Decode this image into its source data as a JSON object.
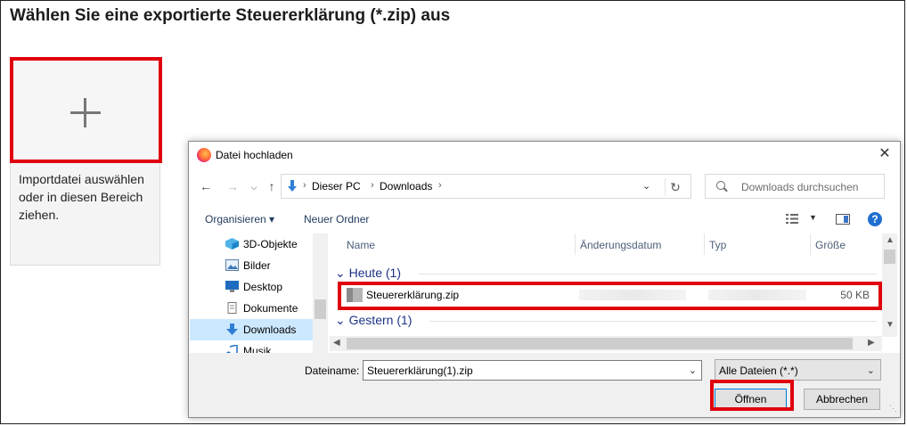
{
  "page": {
    "title": "Wählen Sie eine exportierte Steuererklärung (*.zip) aus",
    "drop_zone_text": "Importdatei auswählen oder in diesen Bereich ziehen."
  },
  "dialog": {
    "title": "Datei hochladen",
    "close_glyph": "✕",
    "breadcrumb": [
      "Dieser PC",
      "Downloads"
    ],
    "search_placeholder": "Downloads durchsuchen",
    "toolbar": {
      "organize": "Organisieren ▾",
      "new_folder": "Neuer Ordner"
    },
    "nav_items": [
      {
        "label": "3D-Objekte",
        "icon": "cube-icon"
      },
      {
        "label": "Bilder",
        "icon": "pictures-icon"
      },
      {
        "label": "Desktop",
        "icon": "desktop-icon"
      },
      {
        "label": "Dokumente",
        "icon": "documents-icon"
      },
      {
        "label": "Downloads",
        "icon": "download-arrow-icon",
        "selected": true
      },
      {
        "label": "Musik",
        "icon": "music-icon"
      }
    ],
    "columns": [
      "Name",
      "Änderungsdatum",
      "Typ",
      "Größe"
    ],
    "groups": [
      {
        "label": "Heute (1)"
      },
      {
        "label": "Gestern (1)"
      }
    ],
    "file": {
      "name": "Steuererklärung.zip",
      "size": "50 KB"
    },
    "filename_label": "Dateiname:",
    "filename_value": "Steuererklärung(1).zip",
    "file_type": "Alle Dateien (*.*)",
    "open_label": "Öffnen",
    "cancel_label": "Abbrechen",
    "help_glyph": "?"
  },
  "colors": {
    "highlight": "#e0000d",
    "selected_nav": "#cce8ff",
    "group_header": "#1e3287",
    "accent_blue": "#0078d7"
  }
}
